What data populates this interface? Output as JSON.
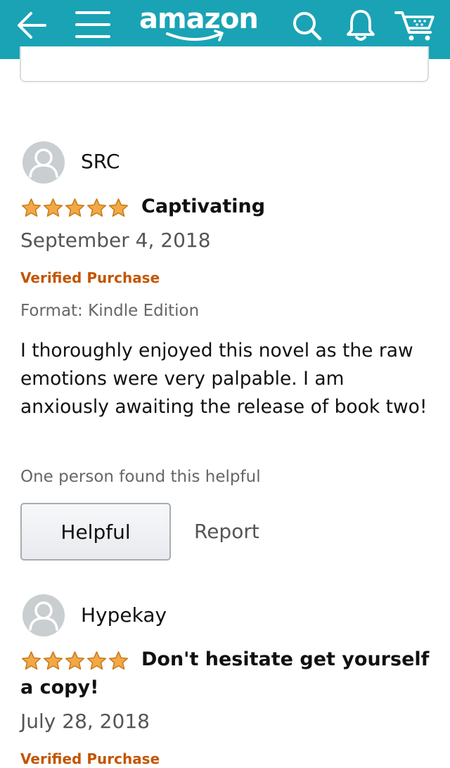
{
  "header": {
    "logo_text": "amazon",
    "icons": [
      "back-arrow-icon",
      "menu-icon",
      "search-icon",
      "notification-bell-icon",
      "cart-icon"
    ],
    "background_color": "#1aa3b5"
  },
  "reviews": [
    {
      "reviewer": "SRC",
      "rating": 5,
      "rating_max": 5,
      "title": "Captivating",
      "date": "September 4, 2018",
      "verified": "Verified Purchase",
      "format": "Format: Kindle Edition",
      "body": "I thoroughly enjoyed this novel as the raw emotions were very palpable. I am anxiously awaiting the release of book two!",
      "helpful_count": "One person found this helpful",
      "helpful_label": "Helpful",
      "report_label": "Report"
    },
    {
      "reviewer": "Hypekay",
      "rating": 5,
      "rating_max": 5,
      "title": "Don't hesitate get yourself a copy!",
      "date": "July 28, 2018",
      "verified": "Verified Purchase"
    }
  ],
  "colors": {
    "star": "#f3a847",
    "verified": "#c45500",
    "header": "#1aa3b5"
  }
}
